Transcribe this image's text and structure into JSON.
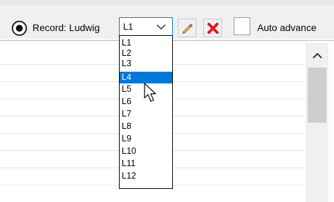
{
  "toolbar": {
    "record_label": "Record: Ludwig",
    "record_selected": true,
    "auto_advance_label": "Auto advance",
    "auto_advance_checked": false
  },
  "combo": {
    "selected": "L1",
    "options": [
      "L1",
      "L2",
      "L3",
      "L4",
      "L5",
      "L6",
      "L7",
      "L8",
      "L9",
      "L10",
      "L11",
      "L12"
    ],
    "highlighted": "L4"
  },
  "icons": {
    "edit": "pencil-icon",
    "delete": "red-x-icon",
    "dropdown": "chevron-down-icon",
    "scroll_up": "chevron-up-icon",
    "cursor": "mouse-pointer-icon"
  },
  "colors": {
    "accent": "#0078d7",
    "delete_red": "#e81123",
    "pencil_yellow": "#f2b84b"
  }
}
